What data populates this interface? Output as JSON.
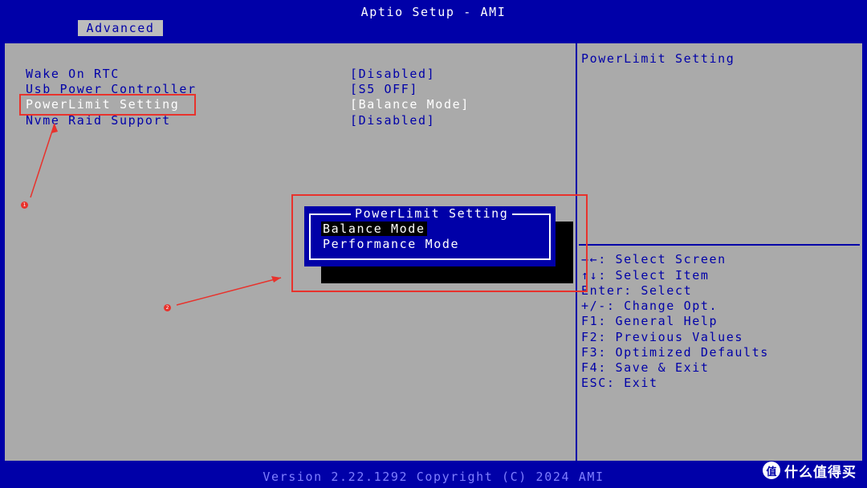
{
  "header": {
    "title": "Aptio Setup - AMI",
    "tab_label": "Advanced"
  },
  "settings": [
    {
      "label": "Wake On RTC",
      "value": "[Disabled]"
    },
    {
      "label": "Usb Power Controller",
      "value": "[S5 OFF]"
    },
    {
      "label": "PowerLimit Setting",
      "value": "[Balance Mode]"
    },
    {
      "label": "Nvme Raid Support",
      "value": "[Disabled]"
    }
  ],
  "help": {
    "description": "PowerLimit Setting",
    "keys": [
      "→←: Select Screen",
      "↑↓: Select Item",
      "Enter: Select",
      "+/-: Change Opt.",
      "F1: General Help",
      "F2: Previous Values",
      "F3: Optimized Defaults",
      "F4: Save & Exit",
      "ESC: Exit"
    ]
  },
  "popup": {
    "title": "PowerLimit Setting",
    "options": [
      "Balance Mode",
      "Performance Mode"
    ],
    "selected_index": 0
  },
  "footer": {
    "version": "Version 2.22.1292 Copyright (C) 2024 AMI"
  },
  "annotations": {
    "marker_1": "1",
    "marker_2": "2",
    "color": "#e8322c"
  },
  "watermark": {
    "logo_char": "值",
    "text": "什么值得买"
  },
  "colors": {
    "bios_blue": "#0000a8",
    "bios_gray": "#aaaaaa",
    "white": "#ffffff"
  }
}
